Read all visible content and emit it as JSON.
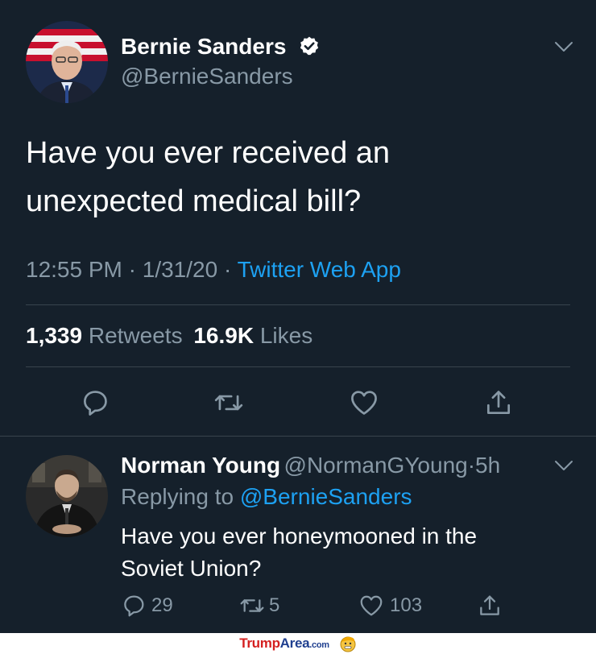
{
  "tweet": {
    "author_name": "Bernie Sanders",
    "author_handle": "@BernieSanders",
    "text_line1": "Have you ever received an",
    "text_line2": "unexpected medical bill?",
    "time": "12:55 PM",
    "date": "1/31/20",
    "source": "Twitter Web App",
    "separator": "·",
    "retweet_count": "1,339",
    "retweet_label": "Retweets",
    "like_count": "16.9K",
    "like_label": "Likes"
  },
  "reply": {
    "author_name": "Norman Young",
    "author_handle": "@NormanGYoung",
    "age": "5h",
    "separator": "·",
    "replying_label": "Replying to",
    "replying_to": "@BernieSanders",
    "text_line1": "Have you ever honeymooned in the",
    "text_line2": "Soviet Union?",
    "reply_count": "29",
    "retweet_count": "5",
    "like_count": "103"
  },
  "watermark": {
    "brand_part1": "Trump",
    "brand_part2": "Area",
    "brand_suffix": ".com"
  },
  "colors": {
    "background": "#15202b",
    "text_primary": "#ffffff",
    "text_secondary": "#8899a6",
    "accent": "#1da1f2",
    "divider": "#38444d"
  },
  "icons": {
    "reply": "reply-icon",
    "retweet": "retweet-icon",
    "like": "heart-icon",
    "share": "share-icon",
    "verified": "verified-badge-icon",
    "menu": "chevron-down-icon"
  }
}
